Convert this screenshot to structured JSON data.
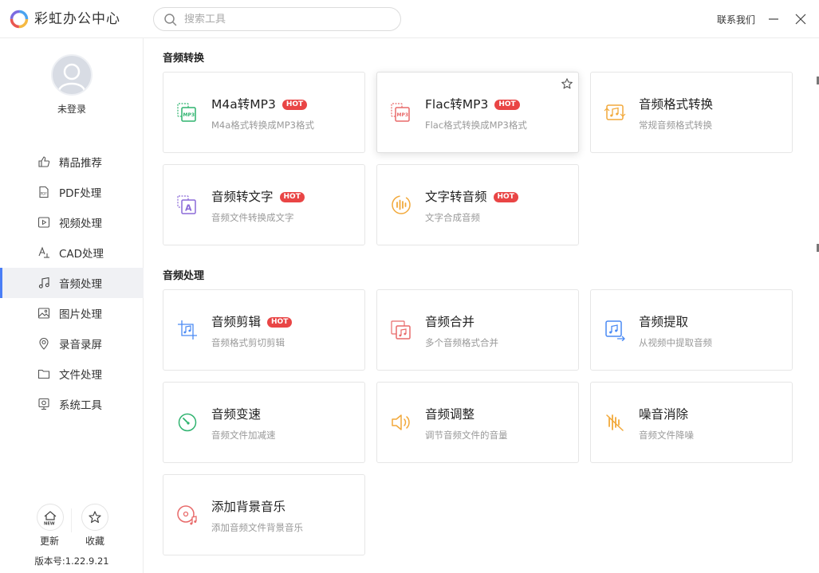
{
  "app": {
    "title": "彩虹办公中心"
  },
  "search": {
    "placeholder": "搜索工具"
  },
  "header": {
    "contact": "联系我们"
  },
  "user": {
    "status": "未登录"
  },
  "sidebar": {
    "items": [
      {
        "label": "精品推荐",
        "icon": "thumbs-up-icon"
      },
      {
        "label": "PDF处理",
        "icon": "pdf-icon"
      },
      {
        "label": "视频处理",
        "icon": "video-icon"
      },
      {
        "label": "CAD处理",
        "icon": "cad-icon"
      },
      {
        "label": "音频处理",
        "icon": "music-note-icon"
      },
      {
        "label": "图片处理",
        "icon": "image-icon"
      },
      {
        "label": "录音录屏",
        "icon": "record-icon"
      },
      {
        "label": "文件处理",
        "icon": "folder-icon"
      },
      {
        "label": "系统工具",
        "icon": "system-icon"
      }
    ],
    "active_index": 4,
    "update_label": "更新",
    "update_badge": "NEW",
    "favorites_label": "收藏",
    "version": "版本号:1.22.9.21"
  },
  "sections": [
    {
      "title": "音频转换",
      "cards": [
        {
          "title": "M4a转MP3",
          "desc": "M4a格式转换成MP3格式",
          "hot": "HOT",
          "icon": "m4a-to-mp3-icon",
          "color": "#2fb36f"
        },
        {
          "title": "Flac转MP3",
          "desc": "Flac格式转换成MP3格式",
          "hot": "HOT",
          "icon": "flac-to-mp3-icon",
          "color": "#e86a6a"
        },
        {
          "title": "音频格式转换",
          "desc": "常规音频格式转换",
          "hot": "",
          "icon": "audio-convert-icon",
          "color": "#f2a93b"
        },
        {
          "title": "音频转文字",
          "desc": "音频文件转换成文字",
          "hot": "HOT",
          "icon": "audio-to-text-icon",
          "color": "#8b6ad8"
        },
        {
          "title": "文字转音频",
          "desc": "文字合成音频",
          "hot": "HOT",
          "icon": "text-to-audio-icon",
          "color": "#f2a93b"
        }
      ]
    },
    {
      "title": "音频处理",
      "cards": [
        {
          "title": "音频剪辑",
          "desc": "音频格式剪切剪辑",
          "hot": "HOT",
          "icon": "audio-cut-icon",
          "color": "#4a8af4"
        },
        {
          "title": "音频合并",
          "desc": "多个音频格式合并",
          "hot": "",
          "icon": "audio-merge-icon",
          "color": "#e86a6a"
        },
        {
          "title": "音频提取",
          "desc": "从视频中提取音频",
          "hot": "",
          "icon": "audio-extract-icon",
          "color": "#4a8af4"
        },
        {
          "title": "音频变速",
          "desc": "音频文件加减速",
          "hot": "",
          "icon": "audio-speed-icon",
          "color": "#2fb36f"
        },
        {
          "title": "音频调整",
          "desc": "调节音频文件的音量",
          "hot": "",
          "icon": "volume-icon",
          "color": "#f2a93b"
        },
        {
          "title": "噪音消除",
          "desc": "音频文件降噪",
          "hot": "",
          "icon": "noise-removal-icon",
          "color": "#f2a93b"
        },
        {
          "title": "添加背景音乐",
          "desc": "添加音频文件背景音乐",
          "hot": "",
          "icon": "background-music-icon",
          "color": "#e86a6a"
        }
      ]
    }
  ]
}
